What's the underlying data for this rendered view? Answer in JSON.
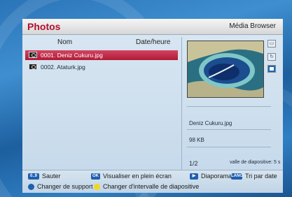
{
  "header": {
    "title": "Photos",
    "app_name": "Média Browser"
  },
  "columns": {
    "name": "Nom",
    "date": "Date/heure"
  },
  "files": [
    {
      "label": "0001. Deniz Cukuru.jpg",
      "selected": true
    },
    {
      "label": "0002. Ataturk.jpg",
      "selected": false
    }
  ],
  "details": {
    "file_name": "Deniz Cukuru.jpg",
    "file_size": "98 KB",
    "page": "1/2",
    "slide_interval": "valle de diapositive: 5 s"
  },
  "footer": {
    "jump_key": "0..9",
    "jump_label": "Sauter",
    "ok_key": "OK",
    "fullscreen_label": "Visualiser en plein écran",
    "slideshow_label": "Diaporama",
    "lang_key": "LANG",
    "sort_label": "Tri par date",
    "change_support_label": "Changer de support",
    "change_interval_label": "Changer d'intervalle de diapositive"
  },
  "colors": {
    "accent": "#b3102e",
    "selection": "#c52b49",
    "key_blue": "#1e5fb0",
    "key_yellow": "#f2d81c"
  },
  "icons": [
    "camera-icon",
    "image-icon",
    "rotate-icon",
    "stop-icon",
    "play-icon"
  ]
}
